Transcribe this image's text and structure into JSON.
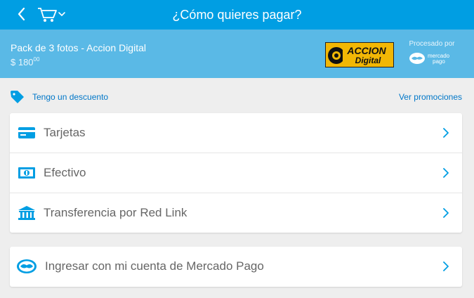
{
  "header": {
    "title": "¿Cómo quieres pagar?"
  },
  "summary": {
    "description": "Pack de 3 fotos - Accion Digital",
    "price_main": "$ 180",
    "price_cents": "00",
    "merchant_logo": {
      "line1": "ACCION",
      "line2": "Digital"
    },
    "processed_by": "Procesado por",
    "mp_logo": {
      "line1": "mercado",
      "line2": "pago"
    }
  },
  "discount": {
    "link": "Tengo un descuento",
    "promotions": "Ver promociones"
  },
  "payment_options": [
    {
      "label": "Tarjetas",
      "icon": "card-icon"
    },
    {
      "label": "Efectivo",
      "icon": "cash-icon"
    },
    {
      "label": "Transferencia por Red Link",
      "icon": "bank-icon"
    }
  ],
  "account_option": {
    "label": "Ingresar con mi cuenta de Mercado Pago",
    "icon": "mercadopago-handshake-icon"
  },
  "colors": {
    "topbar": "#009ee3",
    "summary": "#5ab9e6",
    "link": "#0077c8",
    "icon_blue": "#009ee3"
  }
}
